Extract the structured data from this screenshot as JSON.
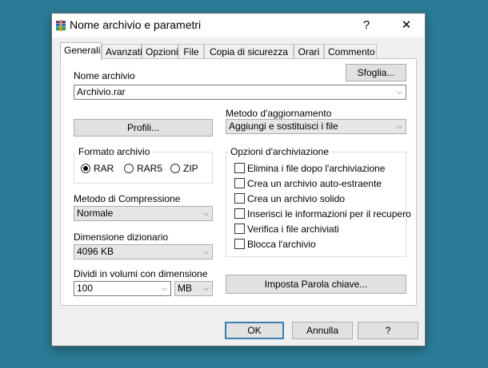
{
  "window": {
    "title": "Nome archivio e parametri",
    "help_glyph": "?",
    "close_glyph": "✕"
  },
  "tabs": [
    {
      "label": "Generali",
      "active": true
    },
    {
      "label": "Avanzati"
    },
    {
      "label": "Opzioni"
    },
    {
      "label": "File"
    },
    {
      "label": "Copia di sicurezza"
    },
    {
      "label": "Orari"
    },
    {
      "label": "Commento"
    }
  ],
  "archive_name": {
    "label": "Nome archivio",
    "value": "Archivio.rar",
    "browse_label": "Sfoglia..."
  },
  "update_method": {
    "label": "Metodo d'aggiornamento",
    "value": "Aggiungi e sostituisci i file"
  },
  "profiles_label": "Profili...",
  "archive_format": {
    "label": "Formato archivio",
    "options": [
      {
        "label": "RAR",
        "selected": true
      },
      {
        "label": "RAR5",
        "selected": false
      },
      {
        "label": "ZIP",
        "selected": false
      }
    ]
  },
  "compression": {
    "label": "Metodo di Compressione",
    "value": "Normale"
  },
  "dictionary": {
    "label": "Dimensione dizionario",
    "value": "4096 KB"
  },
  "split": {
    "label": "Dividi in volumi con dimensione",
    "value": "100",
    "unit": "MB"
  },
  "archive_options": {
    "label": "Opzioni d'archiviazione",
    "items": [
      {
        "label": "Elimina i file dopo l'archiviazione",
        "checked": false
      },
      {
        "label": "Crea un archivio auto-estraente",
        "checked": false
      },
      {
        "label": "Crea un archivio solido",
        "checked": false
      },
      {
        "label": "Inserisci le informazioni per il recupero",
        "checked": false
      },
      {
        "label": "Verifica i file archiviati",
        "checked": false
      },
      {
        "label": "Blocca l'archivio",
        "checked": false
      }
    ]
  },
  "password_label": "Imposta Parola chiave...",
  "footer": {
    "ok_label": "OK",
    "cancel_label": "Annulla",
    "help_label": "?"
  },
  "colors": {
    "desktop": "#2b7c97",
    "default_button_border": "#3c7fb1"
  }
}
